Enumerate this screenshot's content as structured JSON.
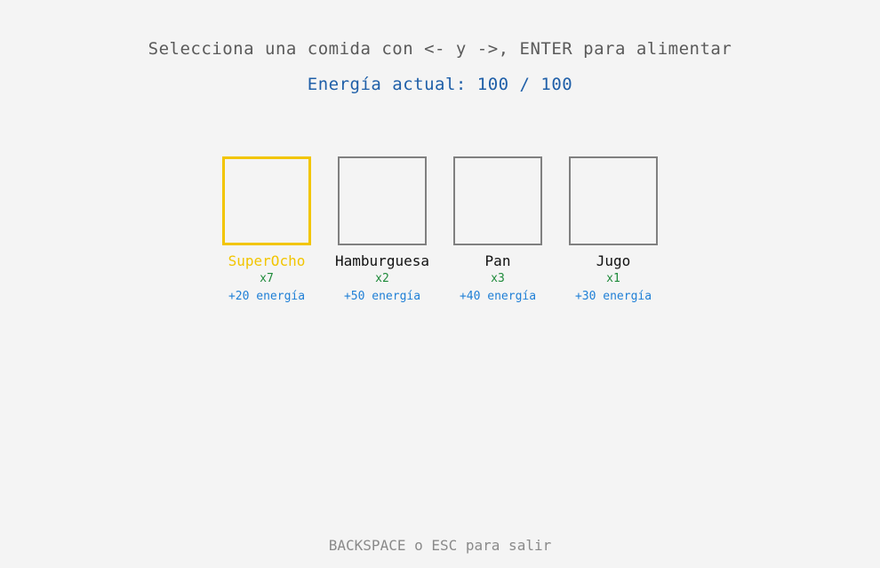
{
  "header": {
    "instructions": "Selecciona una comida con <- y ->, ENTER para alimentar",
    "energy": "Energía actual: 100 / 100"
  },
  "foods": [
    {
      "name": "SuperOcho",
      "quantity": "x7",
      "bonus": "+20 energía",
      "selected": true
    },
    {
      "name": "Hamburguesa",
      "quantity": "x2",
      "bonus": "+50 energía",
      "selected": false
    },
    {
      "name": "Pan",
      "quantity": "x3",
      "bonus": "+40 energía",
      "selected": false
    },
    {
      "name": "Jugo",
      "quantity": "x1",
      "bonus": "+30 energía",
      "selected": false
    }
  ],
  "footer": {
    "hint": "BACKSPACE o ESC para salir"
  },
  "colors": {
    "background": "#f4f4f4",
    "selected": "#f2c500",
    "quantity": "#1e8a3a",
    "bonus": "#1f7fd6",
    "energy": "#1f5fa8"
  }
}
